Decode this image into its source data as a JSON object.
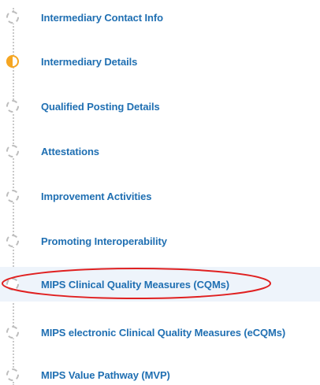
{
  "steps": [
    {
      "label": "Intermediary Contact Info",
      "status": "pending"
    },
    {
      "label": "Intermediary Details",
      "status": "in-progress"
    },
    {
      "label": "Qualified Posting Details",
      "status": "pending"
    },
    {
      "label": "Attestations",
      "status": "pending"
    },
    {
      "label": "Improvement Activities",
      "status": "pending"
    },
    {
      "label": "Promoting Interoperability",
      "status": "pending"
    },
    {
      "label": "MIPS Clinical Quality Measures (CQMs)",
      "status": "pending",
      "highlighted": true
    },
    {
      "label": "MIPS electronic Clinical Quality Measures (eCQMs)",
      "status": "pending"
    },
    {
      "label": "MIPS Value Pathway (MVP)",
      "status": "pending"
    }
  ],
  "colors": {
    "link": "#1f6fb2",
    "in_progress": "#f5a623",
    "pending": "#bdbdbd",
    "highlight_bg": "#eef4fb",
    "annotation": "#e02020"
  }
}
